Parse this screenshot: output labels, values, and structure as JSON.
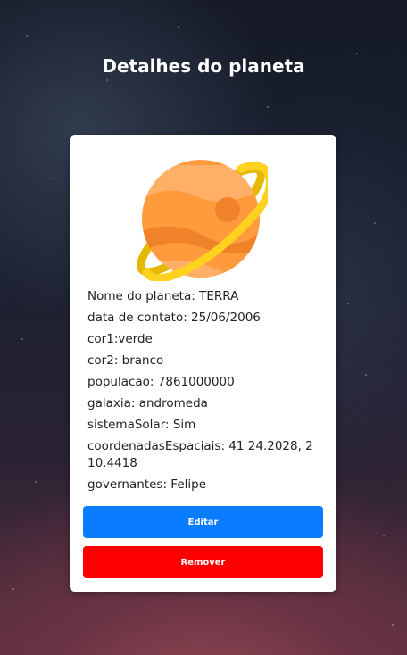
{
  "header": {
    "title": "Detalhes do planeta"
  },
  "planet_image": {
    "icon": "ringed-planet-icon",
    "colors": {
      "planet": "#ff9b3d",
      "ring": "#ffd21f"
    }
  },
  "details": [
    "Nome do planeta: TERRA",
    "data de contato: 25/06/2006",
    "cor1:verde",
    "cor2: branco",
    "populacao: 7861000000",
    "galaxia: andromeda",
    "sistemaSolar: Sim",
    "coordenadasEspaciais: 41 24.2028, 2 10.4418",
    "governantes: Felipe"
  ],
  "actions": {
    "edit_label": "Editar",
    "remove_label": "Remover",
    "edit_color": "#0a7cff",
    "remove_color": "#ff0000"
  }
}
